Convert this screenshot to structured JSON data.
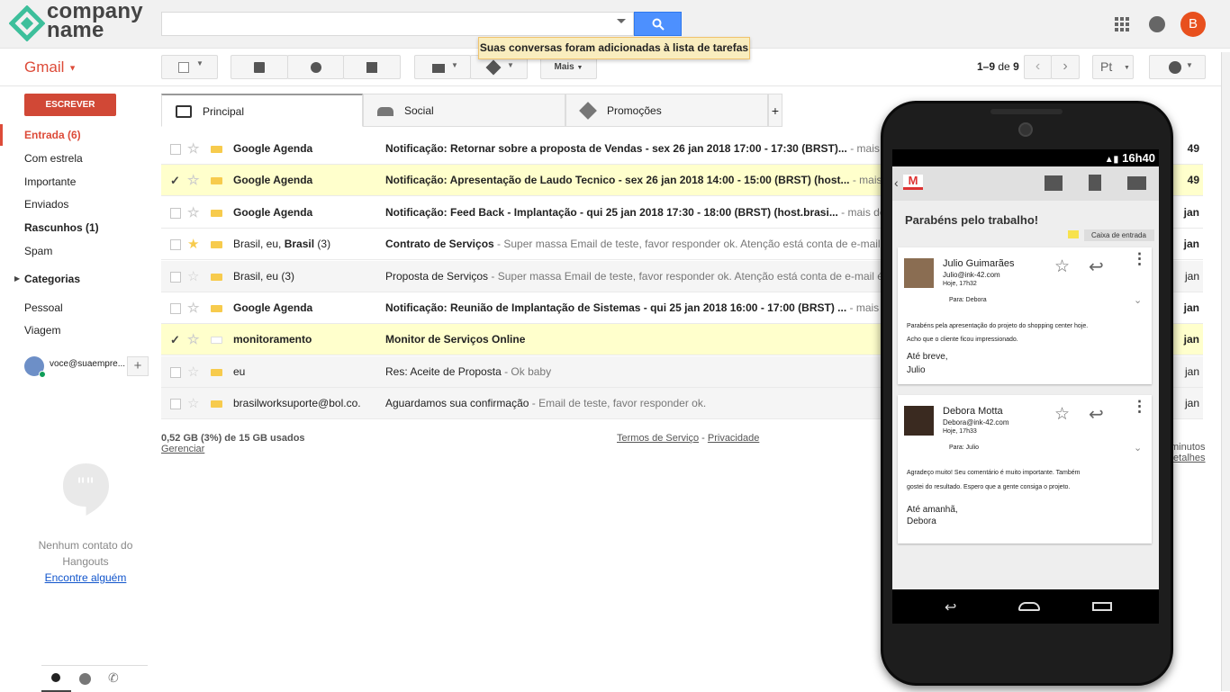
{
  "brand": {
    "line1": "company",
    "line2": "name",
    "mark_color": "#3dbf9b"
  },
  "header": {
    "search_placeholder": "",
    "avatar_letter": "B",
    "toast": "Suas conversas foram adicionadas à lista de tarefas"
  },
  "toolbar": {
    "app_label": "Gmail",
    "more_label": "Mais",
    "pager": {
      "range": "1–9",
      "of": "de",
      "total": "9"
    },
    "lang": "Pt"
  },
  "sidebar": {
    "compose": "ESCREVER",
    "items": [
      {
        "label": "Entrada (6)"
      },
      {
        "label": "Com estrela"
      },
      {
        "label": "Importante"
      },
      {
        "label": "Enviados"
      },
      {
        "label": "Rascunhos (1)"
      },
      {
        "label": "Spam"
      },
      {
        "label": "Categorias"
      },
      {
        "label": "Pessoal"
      },
      {
        "label": "Viagem"
      }
    ],
    "user": "voce@suaempre...",
    "hangouts_empty_line1": "Nenhum contato do",
    "hangouts_empty_line2": "Hangouts",
    "hangouts_link": "Encontre alguém"
  },
  "tabs": [
    {
      "label": "Principal"
    },
    {
      "label": "Social"
    },
    {
      "label": "Promoções"
    },
    {
      "label": "+"
    }
  ],
  "emails": [
    {
      "from": "Google Agenda",
      "subject": "Notificação: Retornar sobre a proposta de Vendas - sex 26 jan 2018 17:00 - 17:30 (BRST)...",
      "snippet": " - mais detalhes",
      "time": "49"
    },
    {
      "from": "Google Agenda",
      "subject": "Notificação: Apresentação de Laudo Tecnico - sex 26 jan 2018 14:00 - 15:00 (BRST) (host...",
      "snippet": " - mais detalhes",
      "time": "49"
    },
    {
      "from": "Google Agenda",
      "subject": "Notificação: Feed Back - Implantação - qui 25 jan 2018 17:30 - 18:00 (BRST) (host.brasi...",
      "snippet": " - mais detalhes",
      "time": "jan"
    },
    {
      "from_a": "Brasil, eu, ",
      "from_b": "Brasil",
      "from_c": " (3)",
      "subject": "Contrato de Serviços",
      "snippet": " - Super massa Email de teste, favor responder ok. Atenção está conta de e-mail é exclusiva",
      "time": "jan"
    },
    {
      "from": "Brasil, eu (3)",
      "subject": "Proposta de Serviços",
      "snippet": " - Super massa Email de teste, favor responder ok. Atenção está conta de e-mail é exclusiva",
      "time": "jan"
    },
    {
      "from": "Google Agenda",
      "subject": "Notificação: Reunião de Implantação de Sistemas - qui 25 jan 2018 16:00 - 17:00 (BRST) ...",
      "snippet": " - mais detalhes",
      "time": "jan"
    },
    {
      "from": "monitoramento",
      "subject": "Monitor de Serviços Online",
      "snippet": "",
      "time": "jan"
    },
    {
      "from": "eu",
      "subject": "Res: Aceite de Proposta",
      "snippet": " - Ok baby",
      "time": "jan"
    },
    {
      "from": "brasilworksuporte@bol.co.",
      "subject": "Aguardamos sua confirmação",
      "snippet": " - Email de teste, favor responder ok.",
      "time": "jan"
    }
  ],
  "footer": {
    "storage": "0,52 GB (3%) de 15 GB usados",
    "manage": "Gerenciar",
    "terms": "Termos de Serviço",
    "sep": " - ",
    "privacy": "Privacidade",
    "right1": "minutos",
    "right2": "etalhes"
  },
  "phone": {
    "time": "16h40",
    "thread_title": "Parabéns pelo trabalho!",
    "label": "Caixa de entrada",
    "messages": [
      {
        "name": "Julio Guimarães",
        "email": "Julio@ink-42.com",
        "when": "Hoje, 17h32",
        "to": "Para: Debora",
        "body1": "Parabéns pela apresentação do projeto do shopping center hoje.",
        "body2": "Acho que o cliente ficou impressionado.",
        "sign1": "Até breve,",
        "sign2": "Julio"
      },
      {
        "name": "Debora Motta",
        "email": "Debora@ink-42.com",
        "when": "Hoje, 17h33",
        "to": "Para: Julio",
        "body1": "Agradeço muito! Seu comentário é muito importante. Também",
        "body2": "gostei do resultado. Espero que a gente consiga o projeto.",
        "sign1": "Até amanhã,",
        "sign2": "Debora"
      }
    ]
  }
}
